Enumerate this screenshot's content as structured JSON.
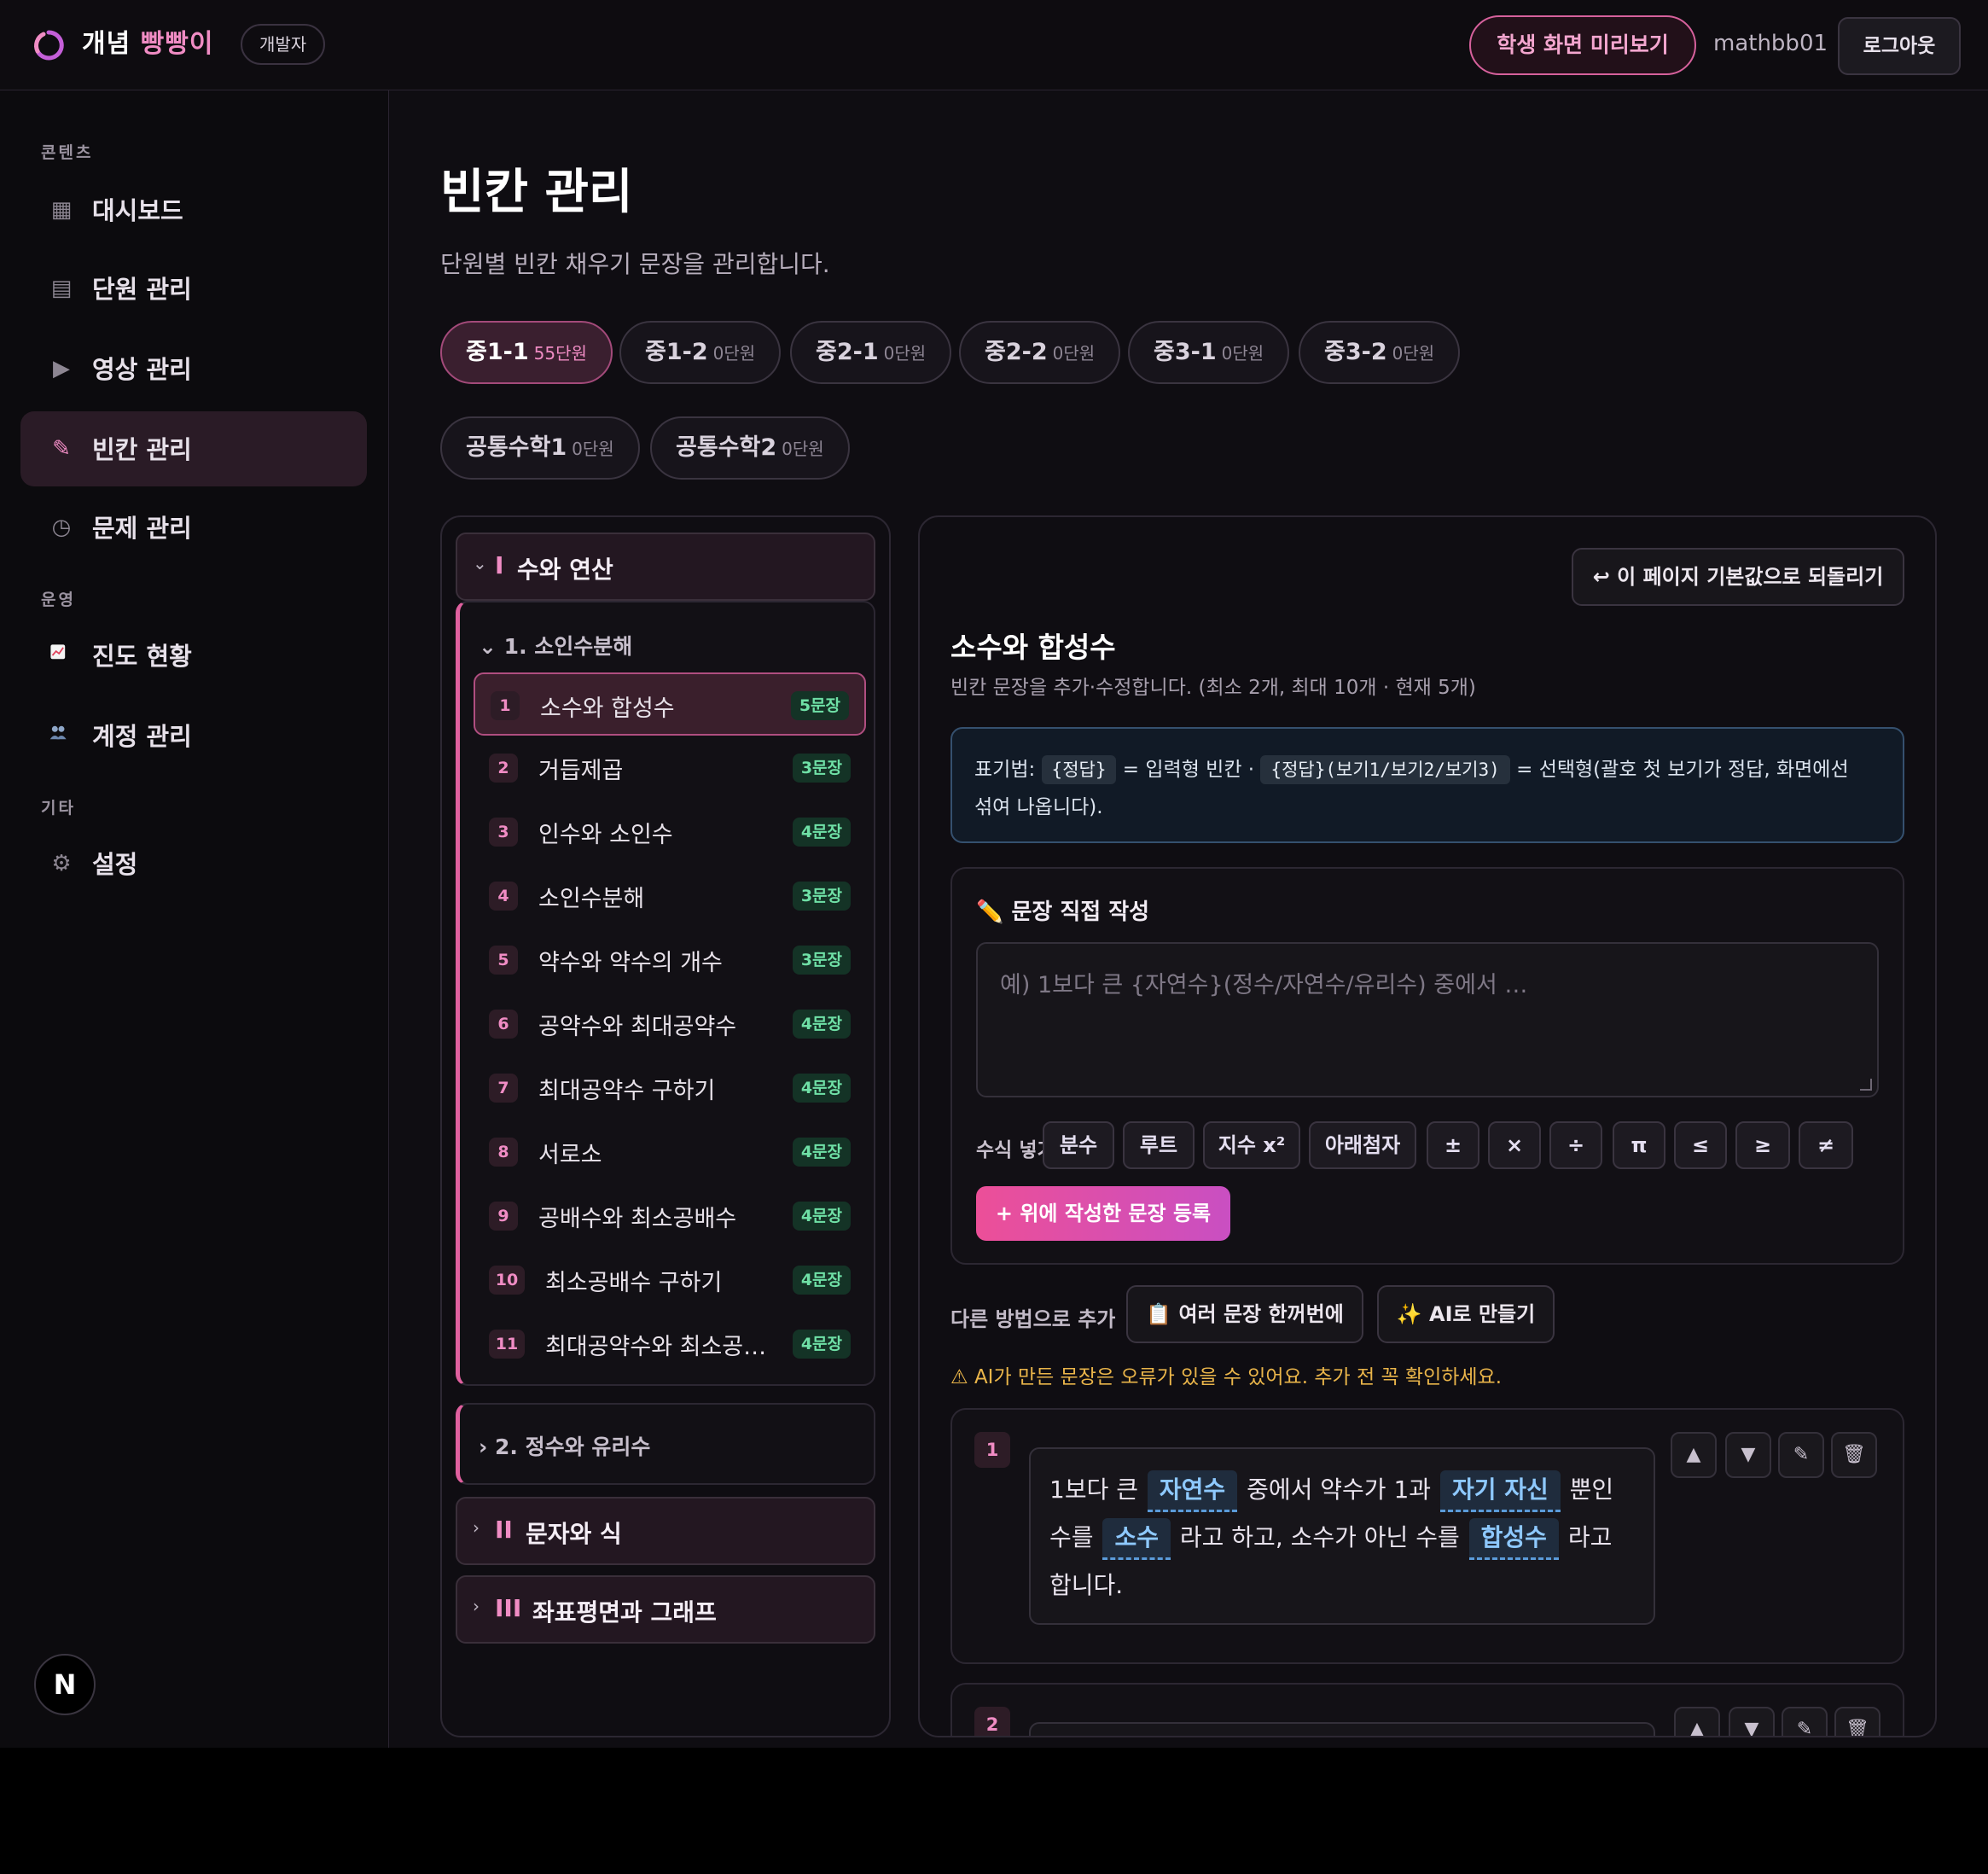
{
  "header": {
    "brand_part1": "개념",
    "brand_part2": "빵빵이",
    "role_badge": "개발자",
    "preview_button": "학생 화면 미리보기",
    "username": "mathbb01",
    "logout_button": "로그아웃",
    "accent_color": "#f08cc4"
  },
  "sidebar": {
    "section_contents": "콘텐츠",
    "section_operations": "운영",
    "section_etc": "기타",
    "items": [
      {
        "label": "대시보드",
        "icon": "grid-icon"
      },
      {
        "label": "단원 관리",
        "icon": "list-icon"
      },
      {
        "label": "영상 관리",
        "icon": "play-icon"
      },
      {
        "label": "빈칸 관리",
        "icon": "pencil-icon",
        "active": true
      },
      {
        "label": "문제 관리",
        "icon": "clock-icon"
      },
      {
        "label": "진도 현황",
        "icon": "chart-icon"
      },
      {
        "label": "계정 관리",
        "icon": "users-icon"
      },
      {
        "label": "설정",
        "icon": "gear-icon"
      }
    ],
    "next_badge": "N"
  },
  "page": {
    "title": "빈칸 관리",
    "description": "단원별 빈칸 채우기 문장을 관리합니다."
  },
  "grade_tabs": [
    {
      "name": "중1-1",
      "count": "55단원",
      "active": true
    },
    {
      "name": "중1-2",
      "count": "0단원"
    },
    {
      "name": "중2-1",
      "count": "0단원"
    },
    {
      "name": "중2-2",
      "count": "0단원"
    },
    {
      "name": "중3-1",
      "count": "0단원"
    },
    {
      "name": "중3-2",
      "count": "0단원"
    },
    {
      "name": "공통수학1",
      "count": "0단원"
    },
    {
      "name": "공통수학2",
      "count": "0단원"
    }
  ],
  "tree": {
    "big_units": [
      {
        "roman": "I",
        "title": "수와 연산",
        "expanded": true
      },
      {
        "roman": "II",
        "title": "문자와 식"
      },
      {
        "roman": "III",
        "title": "좌표평면과 그래프"
      }
    ],
    "mid_units": [
      {
        "title": "1. 소인수분해",
        "expanded": true
      },
      {
        "title": "2. 정수와 유리수"
      }
    ],
    "lessons": [
      {
        "num": "1",
        "name": "소수와 합성수",
        "count": "5문장",
        "active": true
      },
      {
        "num": "2",
        "name": "거듭제곱",
        "count": "3문장"
      },
      {
        "num": "3",
        "name": "인수와 소인수",
        "count": "4문장"
      },
      {
        "num": "4",
        "name": "소인수분해",
        "count": "3문장"
      },
      {
        "num": "5",
        "name": "약수와 약수의 개수",
        "count": "3문장"
      },
      {
        "num": "6",
        "name": "공약수와 최대공약수",
        "count": "4문장"
      },
      {
        "num": "7",
        "name": "최대공약수 구하기",
        "count": "4문장"
      },
      {
        "num": "8",
        "name": "서로소",
        "count": "4문장"
      },
      {
        "num": "9",
        "name": "공배수와 최소공배수",
        "count": "4문장"
      },
      {
        "num": "10",
        "name": "최소공배수 구하기",
        "count": "4문장"
      },
      {
        "num": "11",
        "name": "최대공약수와 최소공…",
        "count": "4문장"
      }
    ]
  },
  "editor": {
    "reset_button": "↩ 이 페이지 기본값으로 되돌리기",
    "title": "소수와 합성수",
    "subtitle": "빈칸 문장을 추가·수정합니다. (최소 2개, 최대 10개 · 현재 5개)",
    "notation": {
      "label": "표기법:",
      "code1": "{정답}",
      "desc1": "= 입력형 빈칸 ·",
      "code2": "{정답}(보기1/보기2/보기3)",
      "desc2": "= 선택형(괄호 첫 보기가 정답, 화면에선",
      "desc3": "섞여 나옵니다)."
    },
    "compose": {
      "title": "문장 직접 작성",
      "placeholder": "예) 1보다 큰 {자연수}(정수/자연수/유리수) 중에서 …",
      "math_label": "수식 넣기",
      "math_buttons": [
        "분수",
        "루트",
        "지수 x²",
        "아래첨자",
        "±",
        "×",
        "÷",
        "π",
        "≤",
        "≥",
        "≠"
      ],
      "submit": "+ 위에 작성한 문장 등록"
    },
    "alt": {
      "label": "다른 방법으로 추가",
      "bulk_button": "여러 문장 한꺼번에",
      "ai_button": "AI로 만들기"
    },
    "warning": "AI가 만든 문장은 오류가 있을 수 있어요. 추가 전 꼭 확인하세요.",
    "sentences": [
      {
        "num": "1",
        "t1": "1보다 큰",
        "b1": "자연수",
        "t2": "중에서 약수가 1과",
        "b2": "자기 자신",
        "t3": "뿐인 수를",
        "b3": "소수",
        "t4": "라고 하고, 소수가 아닌 수를",
        "b4": "합성수",
        "t5": "라고 합니다."
      },
      {
        "num": "2"
      }
    ]
  }
}
